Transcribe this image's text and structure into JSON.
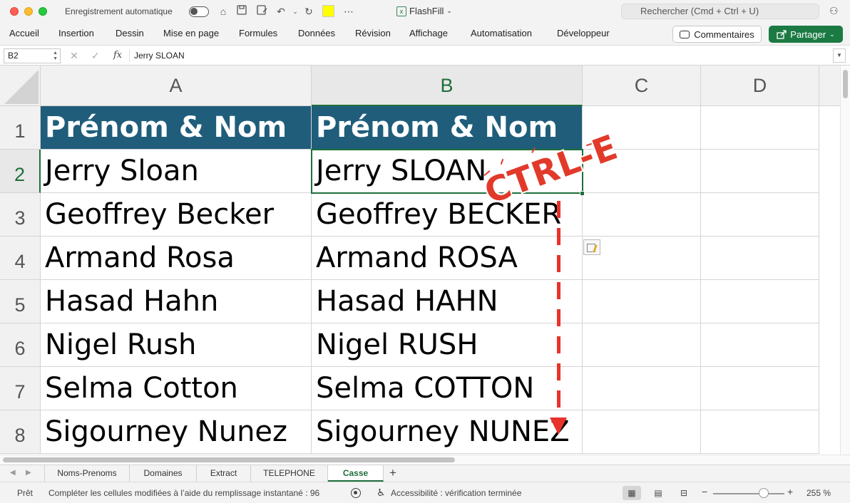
{
  "titlebar": {
    "autosave_label": "Enregistrement automatique",
    "doc_title": "FlashFill",
    "search_placeholder": "Rechercher (Cmd + Ctrl + U)"
  },
  "ribbon": {
    "tabs": [
      "Accueil",
      "Insertion",
      "Dessin",
      "Mise en page",
      "Formules",
      "Données",
      "Révision",
      "Affichage",
      "Automatisation",
      "Développeur"
    ],
    "comments_label": "Commentaires",
    "share_label": "Partager"
  },
  "formula_bar": {
    "cell_ref": "B2",
    "fx_label": "fx",
    "value": "Jerry SLOAN"
  },
  "grid": {
    "columns": [
      "A",
      "B",
      "C",
      "D"
    ],
    "rows": [
      "1",
      "2",
      "3",
      "4",
      "5",
      "6",
      "7",
      "8"
    ],
    "header_row": [
      "Prénom & Nom",
      "Prénom & Nom"
    ],
    "col_a": [
      "Jerry Sloan",
      "Geoffrey Becker",
      "Armand Rosa",
      "Hasad Hahn",
      "Nigel Rush",
      "Selma Cotton",
      "Sigourney Nunez"
    ],
    "col_b": [
      "Jerry SLOAN",
      "Geoffrey BECKER",
      "Armand ROSA",
      "Hasad HAHN",
      "Nigel RUSH",
      "Selma COTTON",
      "Sigourney NUNEZ"
    ],
    "header_color": "#1f5d7b",
    "selection_color": "#1e6e3b"
  },
  "annotation": {
    "stamp_text": "CTRL-E",
    "arrow_color": "#e8322a"
  },
  "sheets": {
    "tabs": [
      "Noms-Prenoms",
      "Domaines",
      "Extract",
      "TELEPHONE",
      "Casse"
    ],
    "active": "Casse",
    "add_label": "+"
  },
  "status": {
    "ready": "Prêt",
    "message": "Compléter les cellules modifiées à l’aide du remplissage instantané : 96",
    "accessibility": "Accessibilité : vérification terminée",
    "zoom_minus": "−",
    "zoom_plus": "+",
    "zoom": "255 %"
  }
}
